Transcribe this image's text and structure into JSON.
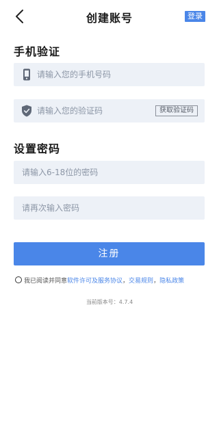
{
  "header": {
    "title": "创建账号",
    "login_label": "登录"
  },
  "phone_section": {
    "title": "手机验证",
    "phone_placeholder": "请输入您的手机号码",
    "code_placeholder": "请输入您的验证码",
    "get_code_label": "获取验证码"
  },
  "password_section": {
    "title": "设置密码",
    "password_placeholder": "请输入6-18位的密码",
    "confirm_placeholder": "请再次输入密码"
  },
  "register_label": "注册",
  "agreement": {
    "prefix": "我已阅读并同意",
    "link1": "软件许可及服务协议",
    "sep1": "，",
    "link2": "交易规则",
    "sep2": "，",
    "link3": "隐私政策"
  },
  "version_text": "当前版本号：4.7.4",
  "colors": {
    "accent": "#4a86e8",
    "field_bg": "#edf1f7"
  }
}
